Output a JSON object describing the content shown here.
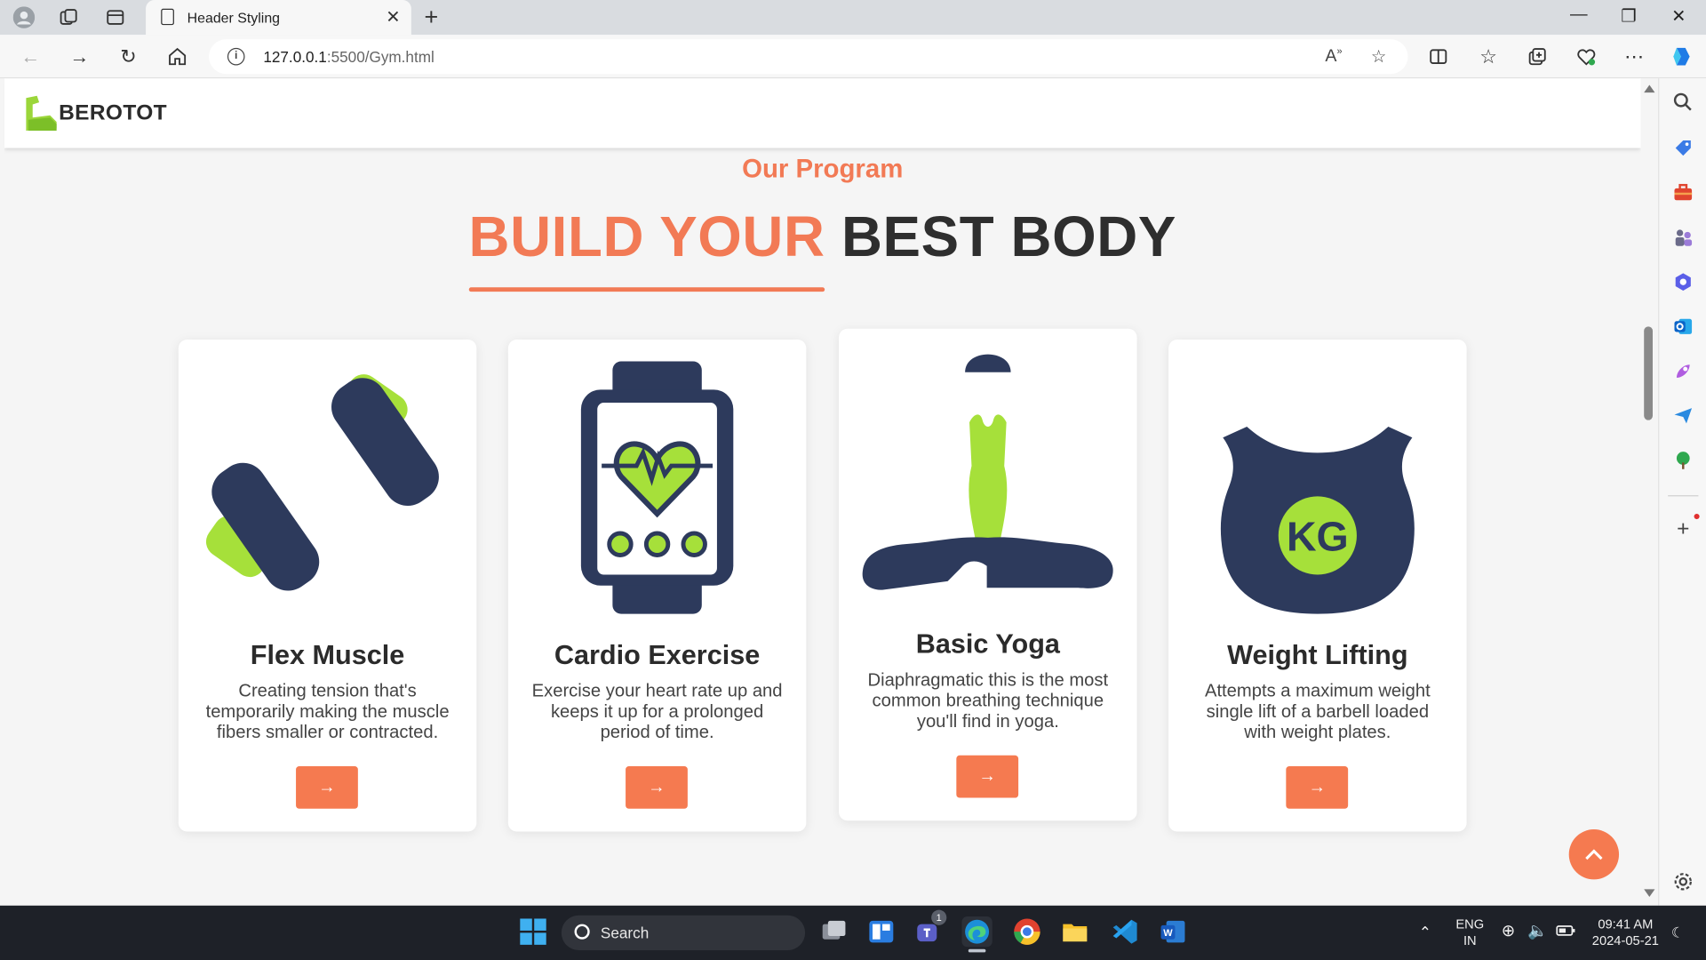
{
  "browser": {
    "tab_title": "Header Styling",
    "url_host": "127.0.0.1",
    "url_path": ":5500/Gym.html"
  },
  "site": {
    "logo_text": "BEROTOT",
    "section_subtitle": "Our Program",
    "title_accent": "BUILD YOUR",
    "title_rest": "BEST BODY"
  },
  "cards": [
    {
      "title": "Flex Muscle",
      "desc": "Creating tension that's temporarily making the muscle fibers smaller or contracted.",
      "icon": "dumbbell-icon"
    },
    {
      "title": "Cardio Exercise",
      "desc": "Exercise your heart rate up and keeps it up for a prolonged period of time.",
      "icon": "smartwatch-heart-icon"
    },
    {
      "title": "Basic Yoga",
      "desc": "Diaphragmatic this is the most common breathing technique you'll find in yoga.",
      "icon": "yoga-pose-icon"
    },
    {
      "title": "Weight Lifting",
      "desc": "Attempts a maximum weight single lift of a barbell loaded with weight plates.",
      "icon": "kettlebell-icon"
    }
  ],
  "kettlebell_label": "KG",
  "card_button_glyph": "→",
  "to_top_glyph": "⌃",
  "taskbar": {
    "search_label": "Search",
    "lang_line1": "ENG",
    "lang_line2": "IN",
    "time": "09:41 AM",
    "date": "2024-05-21",
    "teams_badge": "1"
  },
  "colors": {
    "accent": "#f57a50",
    "navy": "#2d3a5c",
    "lime": "#a6e03a"
  }
}
